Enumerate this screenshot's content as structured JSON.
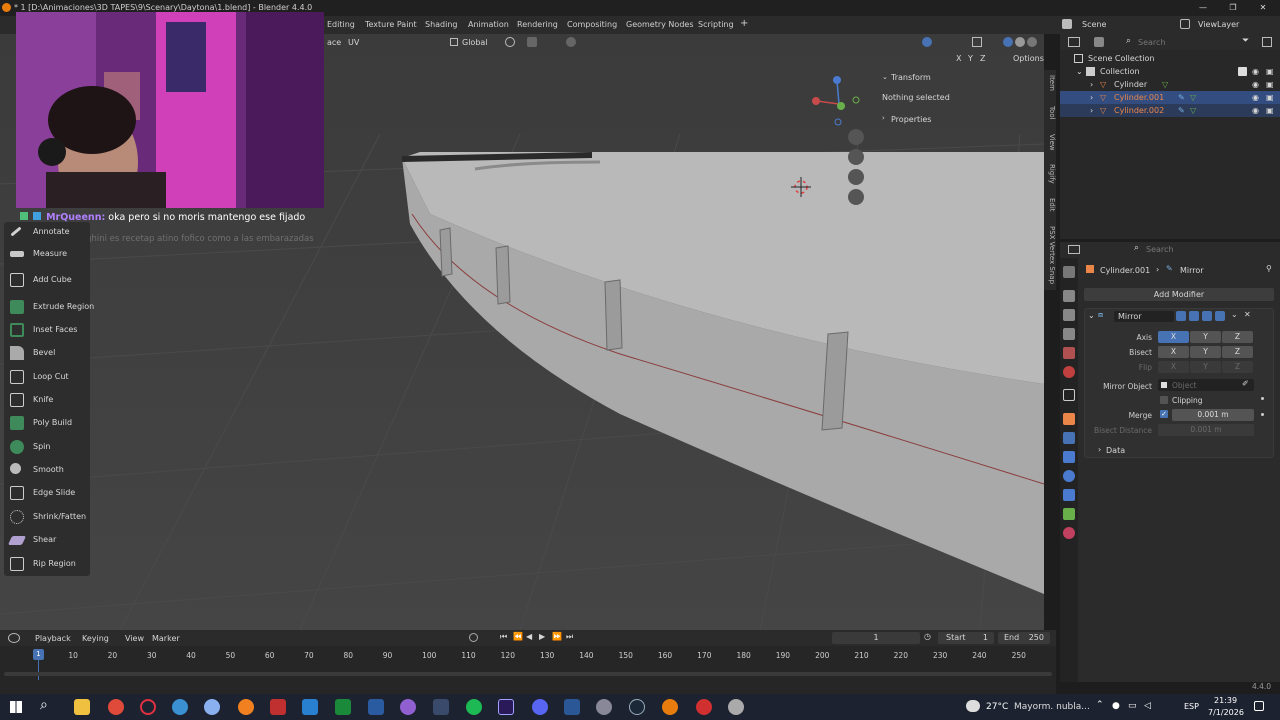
{
  "window": {
    "title": "* 1 [D:\\Animaciones\\3D TAPES\\9\\Scenary\\Daytona\\1.blend] - Blender 4.4.0"
  },
  "workspaces": [
    "Editing",
    "Texture Paint",
    "Shading",
    "Animation",
    "Rendering",
    "Compositing",
    "Geometry Nodes",
    "Scripting"
  ],
  "topright": {
    "scene": "Scene",
    "view_layer": "ViewLayer"
  },
  "viewport_header": {
    "mode_fragment": "ace",
    "uv": "UV",
    "orientation": "Global",
    "options": "Options",
    "axes": [
      "X",
      "Y",
      "Z"
    ]
  },
  "chat": {
    "user": "MrQueenn:",
    "message": "oka pero si no moris mantengo ese fijado",
    "ghost": "el lamborghini es recetap atino fofico como a las embarazadas"
  },
  "toolbar": {
    "items": [
      "Annotate",
      "Measure",
      "Add Cube",
      "Extrude Region",
      "Inset Faces",
      "Bevel",
      "Loop Cut",
      "Knife",
      "Poly Build",
      "Spin",
      "Smooth",
      "Edge Slide",
      "Shrink/Fatten",
      "Shear",
      "Rip Region"
    ]
  },
  "npanel": {
    "transform": "Transform",
    "nothing_selected": "Nothing selected",
    "properties": "Properties",
    "tabs": [
      "Item",
      "Tool",
      "View",
      "Rigify",
      "Edit",
      "PSX Vertex Snap"
    ]
  },
  "outliner": {
    "search_placeholder": "Search",
    "root": "Scene Collection",
    "collection": "Collection",
    "objects": [
      "Cylinder",
      "Cylinder.001",
      "Cylinder.002"
    ]
  },
  "properties": {
    "search_placeholder": "Search",
    "breadcrumb_object": "Cylinder.001",
    "breadcrumb_modifier": "Mirror",
    "add_modifier": "Add Modifier",
    "modifier_name": "Mirror",
    "axis_label": "Axis",
    "bisect_label": "Bisect",
    "flip_label": "Flip",
    "axis_values": [
      "X",
      "Y",
      "Z"
    ],
    "mirror_object_label": "Mirror Object",
    "mirror_object_placeholder": "Object",
    "clipping": "Clipping",
    "merge_label": "Merge",
    "merge_value": "0.001 m",
    "bisect_distance_label": "Bisect Distance",
    "bisect_distance_value": "0.001 m",
    "data_panel": "Data"
  },
  "timeline": {
    "menus": [
      "Playback",
      "Keying",
      "View",
      "Marker"
    ],
    "current_frame": "1",
    "start_label": "Start",
    "start_value": "1",
    "end_label": "End",
    "end_value": "250",
    "ticks": [
      "1",
      "10",
      "20",
      "30",
      "40",
      "50",
      "60",
      "70",
      "80",
      "90",
      "100",
      "110",
      "120",
      "130",
      "140",
      "150",
      "160",
      "170",
      "180",
      "190",
      "200",
      "210",
      "220",
      "230",
      "240",
      "250"
    ],
    "version": "4.4.0"
  },
  "taskbar": {
    "weather_temp": "27°C",
    "weather_text": "Mayorm. nubla...",
    "language": "ESP",
    "time": "21:39",
    "date": "7/1/2026"
  },
  "colors": {
    "accent": "#4772b3",
    "selected_text": "#e98648",
    "mesh_fill": "#b8b8b8"
  }
}
